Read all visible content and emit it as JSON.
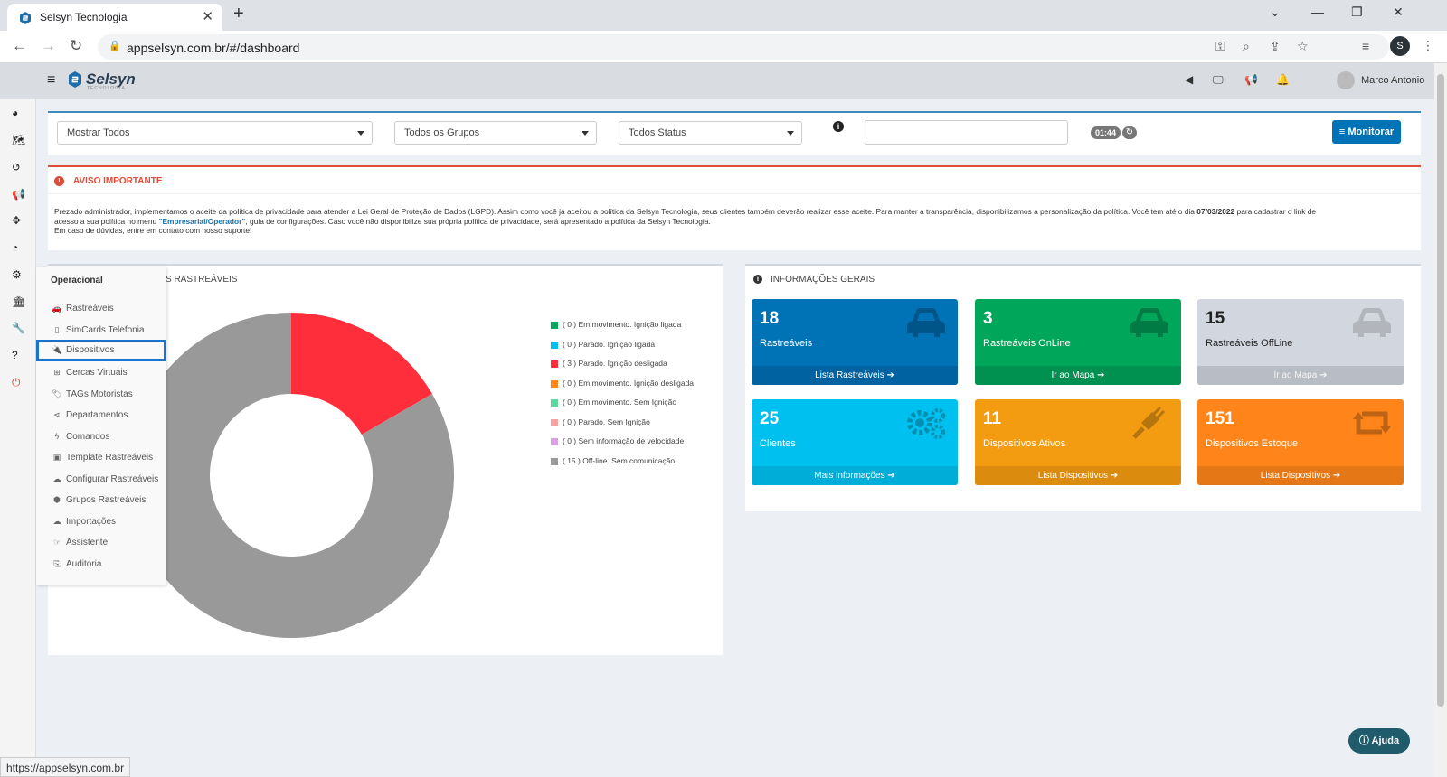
{
  "browser": {
    "tab_title": "Selsyn Tecnologia",
    "url": "appselsyn.com.br/#/dashboard",
    "profile_initial": "S",
    "status_url": "https://appselsyn.com.br"
  },
  "header": {
    "brand": "Selsyn",
    "brand_sub": "TECNOLOGIA",
    "user_name": "Marco Antonio"
  },
  "filters": {
    "vehicles": "Mostrar Todos",
    "groups": "Todos os Grupos",
    "status": "Todos Status",
    "search_value": "",
    "timer": "01:44",
    "monitor_button": "Monitorar"
  },
  "notice": {
    "title": "AVISO IMPORTANTE",
    "line1_a": "Prezado administrador, implementamos o aceite da política de privacidade para atender a Lei Geral de Proteção de Dados (LGPD). Assim como você já aceitou a política da Selsyn Tecnologia, seus clientes também deverão realizar esse aceite. Para manter a transparência, disponibilizamos a personalização da política. Você tem até o dia",
    "deadline": "07/03/2022",
    "line1_b": "para cadastrar o link de",
    "line2_a": "acesso a sua política no menu",
    "menu_path": "\"Empresarial/Operador\"",
    "line2_b": ", guia de configurações. Caso você não disponibilize sua própria política de privacidade, será apresentado a política da Selsyn Tecnologia.",
    "line3": "Em caso de dúvidas, entre em contato com nosso suporte!"
  },
  "chart_panel": {
    "title_fragment": "S RASTREÁVEIS"
  },
  "chart_data": {
    "type": "pie",
    "categories": [
      "( 0 ) Em movimento. Ignição ligada",
      "( 0 ) Parado. Ignição ligada",
      "( 3 ) Parado. Ignição desligada",
      "( 0 ) Em movimento. Ignição desligada",
      "( 0 ) Em movimento. Sem Ignição",
      "( 0 ) Parado. Sem Ignição",
      "( 0 ) Sem informação de velocidade",
      "( 15 ) Off-line. Sem comunicação"
    ],
    "values": [
      0,
      0,
      3,
      0,
      0,
      0,
      0,
      15
    ],
    "colors": [
      "#00a65a",
      "#00c0ef",
      "#ff2e3a",
      "#ff851b",
      "#5fd6a0",
      "#f7a0a0",
      "#d8a3e0",
      "#999999"
    ],
    "legend_position": "right",
    "donut": true
  },
  "info_panel": {
    "title": "INFORMAÇÕES GERAIS",
    "boxes": [
      {
        "number": "18",
        "label": "Rastreáveis",
        "footer": "Lista Rastreáveis",
        "icon": "car-icon",
        "color": "#0073b7",
        "footer_color": "#0062a0"
      },
      {
        "number": "3",
        "label": "Rastreáveis OnLine",
        "footer": "Ir ao Mapa",
        "icon": "car-icon",
        "color": "#00a65a",
        "footer_color": "#009050"
      },
      {
        "number": "15",
        "label": "Rastreáveis OffLine",
        "footer": "Ir ao Mapa",
        "icon": "car-icon",
        "color": "#d2d6de",
        "footer_color": "#b8bcc4"
      },
      {
        "number": "25",
        "label": "Clientes",
        "footer": "Mais informações",
        "icon": "gears-icon",
        "color": "#00c0ef",
        "footer_color": "#00acd8"
      },
      {
        "number": "11",
        "label": "Dispositivos Ativos",
        "footer": "Lista Dispositivos",
        "icon": "plug-icon",
        "color": "#f39c12",
        "footer_color": "#db8c0e"
      },
      {
        "number": "151",
        "label": "Dispositivos Estoque",
        "footer": "Lista Dispositivos",
        "icon": "retweet-icon",
        "color": "#ff851b",
        "footer_color": "#e67716"
      }
    ]
  },
  "menu": {
    "title": "Operacional",
    "items": [
      {
        "label": "Rastreáveis",
        "icon": "car-icon"
      },
      {
        "label": "SimCards Telefonia",
        "icon": "mobile-icon"
      },
      {
        "label": "Dispositivos",
        "icon": "plug-icon"
      },
      {
        "label": "Cercas Virtuais",
        "icon": "fence-icon"
      },
      {
        "label": "TAGs Motoristas",
        "icon": "tags-icon"
      },
      {
        "label": "Departamentos",
        "icon": "share-icon"
      },
      {
        "label": "Comandos",
        "icon": "bolt-icon"
      },
      {
        "label": "Template Rastreáveis",
        "icon": "template-icon"
      },
      {
        "label": "Configurar Rastreáveis",
        "icon": "cloud-icon"
      },
      {
        "label": "Grupos Rastreáveis",
        "icon": "cubes-icon"
      },
      {
        "label": "Importações",
        "icon": "upload-icon"
      },
      {
        "label": "Assistente",
        "icon": "hand-icon"
      },
      {
        "label": "Auditoria",
        "icon": "audit-icon"
      }
    ]
  },
  "help_button": "Ajuda"
}
